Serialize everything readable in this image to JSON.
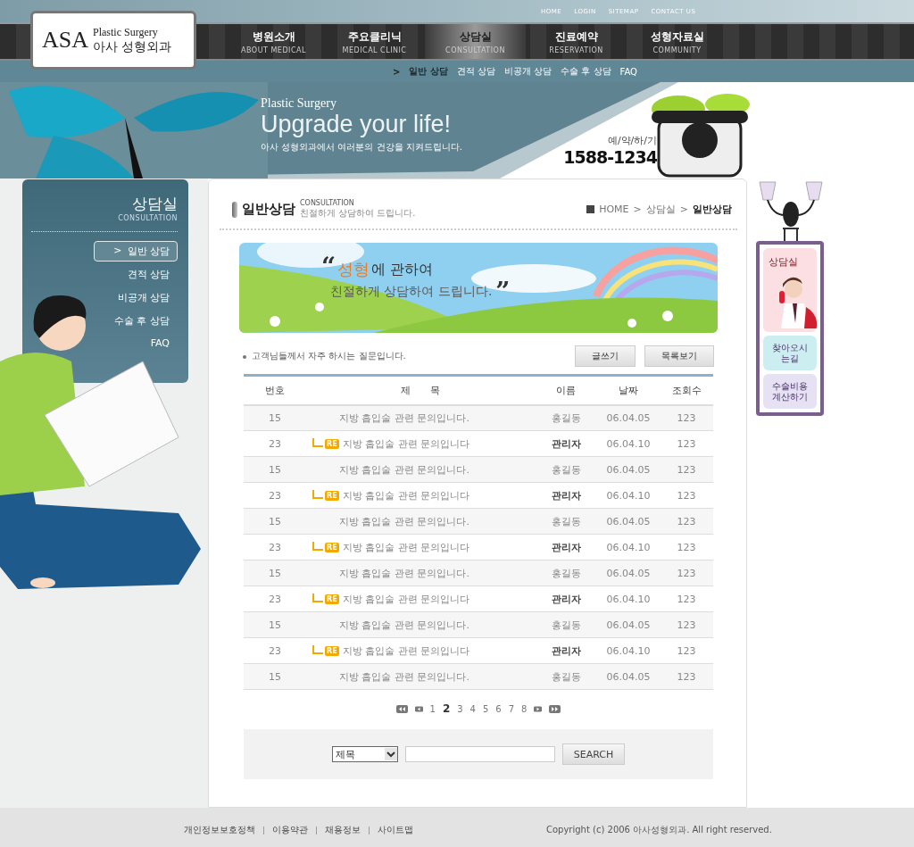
{
  "top_links": [
    "HOME",
    "LOGIN",
    "SITEMAP",
    "CONTACT US"
  ],
  "logo": {
    "mark": "ASA",
    "title": "Plastic Surgery",
    "subtitle": "아사 성형외과"
  },
  "main_nav": [
    {
      "label": "병원소개",
      "sub": "ABOUT MEDICAL",
      "selected": false
    },
    {
      "label": "주요클리닉",
      "sub": "MEDICAL CLINIC",
      "selected": false
    },
    {
      "label": "상담실",
      "sub": "CONSULTATION",
      "selected": true
    },
    {
      "label": "진료예약",
      "sub": "RESERVATION",
      "selected": false
    },
    {
      "label": "성형자료실",
      "sub": "COMMUNITY",
      "selected": false
    }
  ],
  "sub_nav": {
    "marker": ">",
    "items": [
      {
        "label": "일반 상담",
        "selected": true
      },
      {
        "label": "견적 상담",
        "selected": false
      },
      {
        "label": "비공개 상담",
        "selected": false
      },
      {
        "label": "수술 후 상담",
        "selected": false
      },
      {
        "label": "FAQ",
        "selected": false
      }
    ]
  },
  "banner": {
    "kicker": "Plastic Surgery",
    "headline": "Upgrade your life!",
    "caption": "아사 성형외과에서 여러분의 건강을 지켜드립니다.",
    "reserve_label": "예/약/하/기",
    "phone": "1588-1234"
  },
  "side_menu": {
    "title": "상담실",
    "subtitle": "CONSULTATION",
    "marker": ">",
    "items": [
      {
        "label": "일반 상담",
        "selected": true
      },
      {
        "label": "견적 상담",
        "selected": false
      },
      {
        "label": "비공개 상담",
        "selected": false
      },
      {
        "label": "수술 후 상담",
        "selected": false
      },
      {
        "label": "FAQ",
        "selected": false
      }
    ]
  },
  "page_header": {
    "title": "일반상담",
    "en": "CONSULTATION",
    "desc": "친절하게 상담하여 드립니다.",
    "breadcrumb": [
      "HOME",
      "상담실",
      "일반상담"
    ],
    "separator": ">"
  },
  "hero": {
    "quote_open": "“",
    "highlight": "성형",
    "line1_rest": "에 관하여",
    "line2": "친절하게 상담하여 드립니다.",
    "quote_close": "”"
  },
  "notice": "고객님들께서 자주 하시는 질문입니다.",
  "buttons": [
    "글쓰기",
    "목록보기"
  ],
  "table": {
    "columns": [
      "번호",
      "제　　목",
      "이름",
      "날짜",
      "조회수"
    ],
    "rows": [
      {
        "kind": "question",
        "no": "15",
        "title": "지방 흡입술 관련 문의입니다.",
        "name": "홍길동",
        "date": "06.04.05",
        "views": "123"
      },
      {
        "kind": "reply",
        "badge": "RE",
        "no": "23",
        "title": "지방 흡입술 관련 문의입니다",
        "name": "관리자",
        "date": "06.04.10",
        "views": "123"
      },
      {
        "kind": "question",
        "no": "15",
        "title": "지방 흡입술 관련 문의입니다.",
        "name": "홍길동",
        "date": "06.04.05",
        "views": "123"
      },
      {
        "kind": "reply",
        "badge": "RE",
        "no": "23",
        "title": "지방 흡입술 관련 문의입니다",
        "name": "관리자",
        "date": "06.04.10",
        "views": "123"
      },
      {
        "kind": "question",
        "no": "15",
        "title": "지방 흡입술 관련 문의입니다.",
        "name": "홍길동",
        "date": "06.04.05",
        "views": "123"
      },
      {
        "kind": "reply",
        "badge": "RE",
        "no": "23",
        "title": "지방 흡입술 관련 문의입니다",
        "name": "관리자",
        "date": "06.04.10",
        "views": "123"
      },
      {
        "kind": "question",
        "no": "15",
        "title": "지방 흡입술 관련 문의입니다.",
        "name": "홍길동",
        "date": "06.04.05",
        "views": "123"
      },
      {
        "kind": "reply",
        "badge": "RE",
        "no": "23",
        "title": "지방 흡입술 관련 문의입니다",
        "name": "관리자",
        "date": "06.04.10",
        "views": "123"
      },
      {
        "kind": "question",
        "no": "15",
        "title": "지방 흡입술 관련 문의입니다.",
        "name": "홍길동",
        "date": "06.04.05",
        "views": "123"
      },
      {
        "kind": "reply",
        "badge": "RE",
        "no": "23",
        "title": "지방 흡입술 관련 문의입니다",
        "name": "관리자",
        "date": "06.04.10",
        "views": "123"
      },
      {
        "kind": "question",
        "no": "15",
        "title": "지방 흡입술 관련 문의입니다.",
        "name": "홍길동",
        "date": "06.04.05",
        "views": "123"
      }
    ]
  },
  "pagination": [
    {
      "label": "1",
      "selected": false
    },
    {
      "label": "2",
      "selected": true
    },
    {
      "label": "3",
      "selected": false
    },
    {
      "label": "4",
      "selected": false
    },
    {
      "label": "5",
      "selected": false
    },
    {
      "label": "6",
      "selected": false
    },
    {
      "label": "7",
      "selected": false
    },
    {
      "label": "8",
      "selected": false
    }
  ],
  "search": {
    "field": "제목",
    "button": "SEARCH"
  },
  "right_panel": {
    "title": "상담실",
    "links": [
      "찾아오시는길",
      "수술비용 계산하기"
    ]
  },
  "footer": {
    "links": [
      "개인정보보호정책",
      "이용약관",
      "채용정보",
      "사이트맵"
    ],
    "separator": "|",
    "copyright": "Copyright (c) 2006 아사성형외과. All right reserved."
  }
}
